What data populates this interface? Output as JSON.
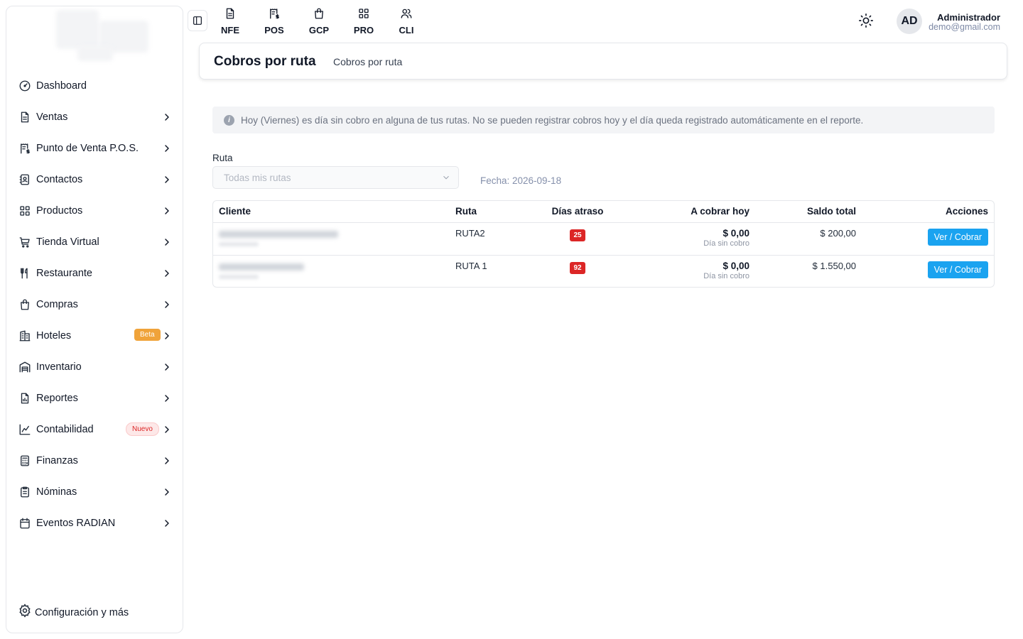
{
  "header": {
    "modules": [
      {
        "label": "NFE",
        "icon": "file-text-icon"
      },
      {
        "label": "POS",
        "icon": "receipt-dollar-icon"
      },
      {
        "label": "GCP",
        "icon": "shopping-bag-icon"
      },
      {
        "label": "PRO",
        "icon": "grid-icon"
      },
      {
        "label": "CLI",
        "icon": "users-icon"
      }
    ],
    "avatar_initials": "AD",
    "user_name": "Administrador",
    "user_email": "demo@gmail.com"
  },
  "sidebar": {
    "items": [
      {
        "label": "Dashboard",
        "icon": "gauge-icon"
      },
      {
        "label": "Ventas",
        "icon": "document-icon"
      },
      {
        "label": "Punto de Venta P.O.S.",
        "icon": "receipt-dollar-icon"
      },
      {
        "label": "Contactos",
        "icon": "contact-book-icon"
      },
      {
        "label": "Productos",
        "icon": "grid-icon"
      },
      {
        "label": "Tienda Virtual",
        "icon": "cart-icon"
      },
      {
        "label": "Restaurante",
        "icon": "utensils-icon"
      },
      {
        "label": "Compras",
        "icon": "shopping-bag-icon"
      },
      {
        "label": "Hoteles",
        "icon": "building-icon",
        "badge": "Beta"
      },
      {
        "label": "Inventario",
        "icon": "warehouse-icon"
      },
      {
        "label": "Reportes",
        "icon": "report-icon"
      },
      {
        "label": "Contabilidad",
        "icon": "chart-icon",
        "badge": "Nuevo"
      },
      {
        "label": "Finanzas",
        "icon": "calculator-icon"
      },
      {
        "label": "Nóminas",
        "icon": "clipboard-icon"
      },
      {
        "label": "Eventos RADIAN",
        "icon": "calendar-icon"
      }
    ],
    "config_label": "Configuración y más"
  },
  "page": {
    "title": "Cobros por ruta",
    "breadcrumb": "Cobros por ruta",
    "alert": "Hoy (Viernes) es día sin cobro en alguna de tus rutas. No se pueden registrar cobros hoy y el día queda registrado automáticamente en el reporte.",
    "ruta_label": "Ruta",
    "ruta_placeholder": "Todas mis rutas",
    "fecha": "Fecha: 2026-09-18"
  },
  "table": {
    "columns": [
      "Cliente",
      "Ruta",
      "Días atraso",
      "A cobrar hoy",
      "Saldo total",
      "Acciones"
    ],
    "rows": [
      {
        "ruta": "RUTA2",
        "dias": "25",
        "cobrar": "$ 0,00",
        "cobrar_sub": "Día sin cobro",
        "saldo": "$ 200,00",
        "accion": "Ver / Cobrar"
      },
      {
        "ruta": "RUTA 1",
        "dias": "92",
        "cobrar": "$ 0,00",
        "cobrar_sub": "Día sin cobro",
        "saldo": "$ 1.550,00",
        "accion": "Ver / Cobrar"
      }
    ]
  },
  "colors": {
    "accent_button": "#1aa3f0",
    "danger_badge": "#dc2626",
    "beta_badge": "#f0a33a"
  }
}
